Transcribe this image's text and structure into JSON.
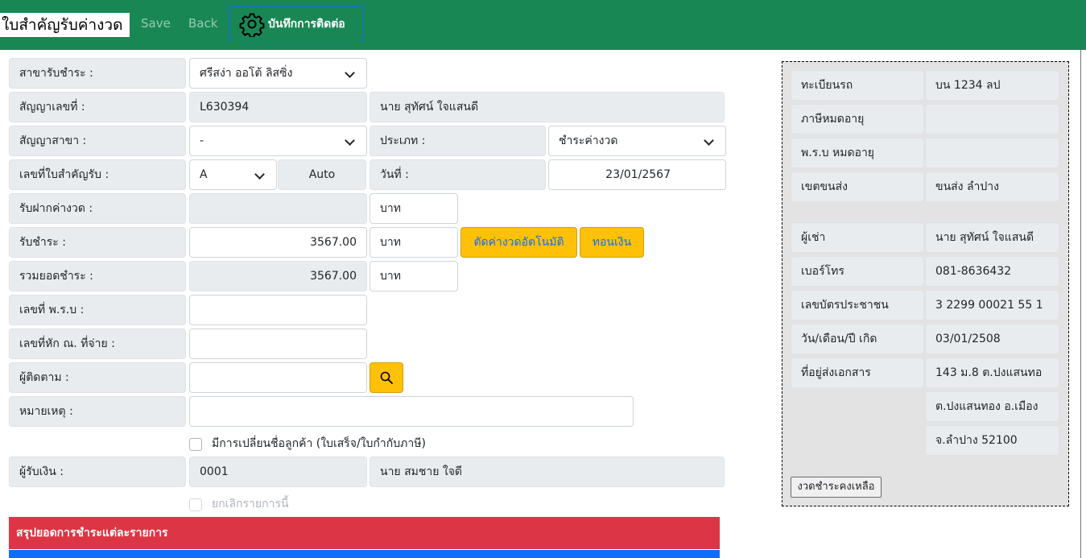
{
  "header": {
    "title": "ใบสำคัญรับค่างวด",
    "save_label": "Save",
    "back_label": "Back",
    "contact_label": "บันทึกการติดต่อ",
    "colors": {
      "bar": "#198754",
      "contact_border": "#0d6efd"
    }
  },
  "form": {
    "branch_label": "สาขารับชำระ :",
    "branch_value": "ศรีสง่า ออโต้ ลิสซิ่ง",
    "contract_no_label": "สัญญาเลขที่ :",
    "contract_no_value": "L630394",
    "contract_name_value": "นาย สุทัศน์ ใจแสนดี",
    "contract_branch_label": "สัญญาสาขา :",
    "contract_branch_value": "-",
    "type_label": "ประเภท :",
    "type_value": "ชำระค่างวด",
    "receipt_no_label": "เลขที่ใบสำคัญรับ :",
    "receipt_prefix_value": "A",
    "receipt_auto_value": "Auto",
    "date_label": "วันที่ :",
    "date_value": "23/01/2567",
    "deposit_label": "รับฝากค่างวด :",
    "deposit_value": "",
    "deposit_unit": "บาท",
    "paid_label": "รับชำระ :",
    "paid_value": "3567.00",
    "paid_unit": "บาท",
    "auto_deduct_label": "ตัดค่างวดอัตโนมัติ",
    "refund_label": "ทอนเงิน",
    "total_label": "รวมยอดชำระ :",
    "total_value": "3567.00",
    "total_unit": "บาท",
    "prb_no_label": "เลขที่ พ.ร.บ :",
    "prb_no_value": "",
    "tax_deduct_label": "เลขที่หัก ณ. ที่จ่าย :",
    "tax_deduct_value": "",
    "follower_label": "ผู้ติดตาม :",
    "follower_value": "",
    "note_label": "หมายเหตุ :",
    "note_value": "",
    "change_name_label": "มีการเปลี่ยนชื่อลูกค้า (ใบเสร็จ/ใบกำกับภาษี)",
    "receiver_label": "ผู้รับเงิน :",
    "receiver_code_value": "0001",
    "receiver_name_value": "นาย สมชาย ใจดี",
    "cancel_label": "ยกเลิกรายการนี้"
  },
  "summary": {
    "title": "สรุปยอดการชำระแต่ละรายการ",
    "colors": {
      "header": "#dc3545",
      "strip": "#0d6efd"
    }
  },
  "side_panel": {
    "plate_label": "ทะเบียนรถ",
    "plate_value": "บน 1234 ลป",
    "tax_expire_label": "ภาษีหมดอายุ",
    "tax_expire_value": "",
    "prb_expire_label": "พ.ร.บ หมดอายุ",
    "prb_expire_value": "",
    "transport_zone_label": "เขตขนส่ง",
    "transport_zone_value": "ขนส่ง ลำปาง",
    "lessee_label": "ผู้เช่า",
    "lessee_value": "นาย สุทัศน์ ใจแสนดี",
    "phone_label": "เบอร์โทร",
    "phone_value": "081-8636432",
    "id_card_label": "เลขบัตรประชาชน",
    "id_card_value": "3 2299 00021 55 1",
    "birth_label": "วัน/เดือน/ปี เกิด",
    "birth_value": "03/01/2508",
    "address_label": "ที่อยู่ส่งเอกสาร",
    "address_line1": "143  ม.8 ต.ปงแสนทอ",
    "address_line2": "ต.ปงแสนทอง อ.เมือง",
    "address_line3": "จ.ลำปาง 52100",
    "remaining_button_label": "งวดชำระคงเหลือ"
  },
  "accent_colors": {
    "warning": "#ffc107",
    "link_blue": "#0d6efd"
  }
}
